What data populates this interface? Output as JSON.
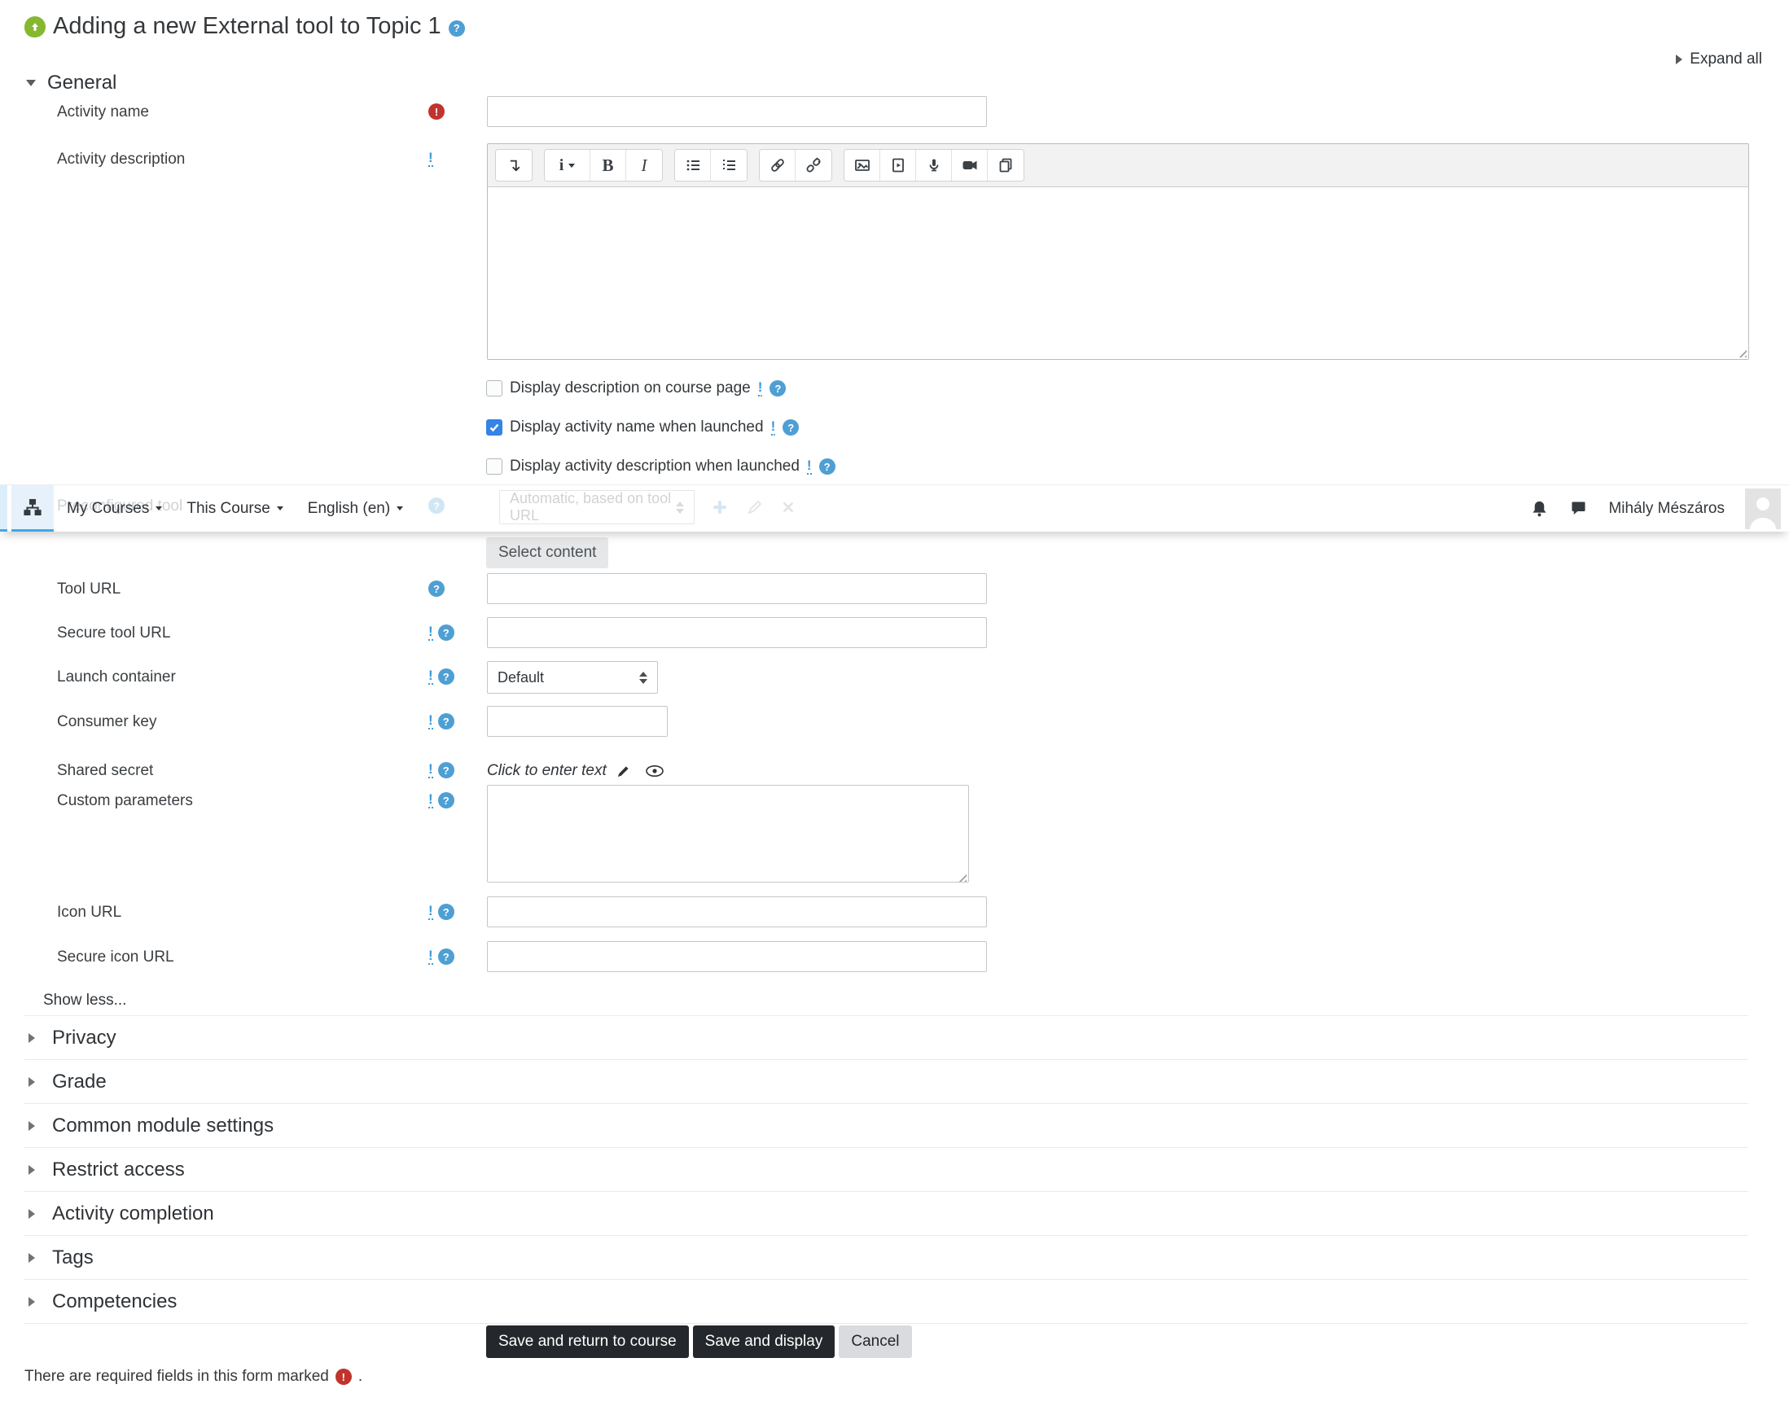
{
  "header": {
    "title": "Adding a new External tool to Topic 1",
    "expand_all": "Expand all"
  },
  "navbar": {
    "items": [
      {
        "label": "My Courses"
      },
      {
        "label": "This Course"
      },
      {
        "label": "English (en)"
      }
    ],
    "user_name": "Mihály Mészáros"
  },
  "general": {
    "heading": "General",
    "activity_name_label": "Activity name",
    "activity_description_label": "Activity description",
    "checkboxes": [
      {
        "label": "Display description on course page",
        "checked": false
      },
      {
        "label": "Display activity name when launched",
        "checked": true
      },
      {
        "label": "Display activity description when launched",
        "checked": false
      }
    ],
    "preconfigured_label": "Preconfigured tool",
    "preconfigured_value": "Automatic, based on tool URL",
    "select_content_label": "Select content",
    "fields": [
      {
        "label": "Tool URL"
      },
      {
        "label": "Secure tool URL"
      },
      {
        "label": "Launch container",
        "value": "Default"
      },
      {
        "label": "Consumer key"
      },
      {
        "label": "Shared secret",
        "value": "Click to enter text"
      },
      {
        "label": "Custom parameters"
      },
      {
        "label": "Icon URL"
      },
      {
        "label": "Secure icon URL"
      }
    ],
    "show_less": "Show less..."
  },
  "icons": {
    "help_glyph": "?",
    "required_glyph": "!",
    "warn_glyph": "!",
    "toolbar_toggle_glyph": "↴",
    "font_menu_glyph": "i",
    "bold_glyph": "B",
    "italic_glyph": "I"
  },
  "sections": [
    {
      "label": "Privacy"
    },
    {
      "label": "Grade"
    },
    {
      "label": "Common module settings"
    },
    {
      "label": "Restrict access"
    },
    {
      "label": "Activity completion"
    },
    {
      "label": "Tags"
    },
    {
      "label": "Competencies"
    }
  ],
  "footer": {
    "buttons": [
      {
        "label": "Save and return to course"
      },
      {
        "label": "Save and display"
      },
      {
        "label": "Cancel"
      }
    ],
    "required_note": "There are required fields in this form marked",
    "required_note_suffix": "."
  },
  "colors": {
    "accent_blue": "#3fa9ea",
    "help_blue": "#4e9fd3",
    "required_red": "#c0342d",
    "checkbox_blue": "#3584e4",
    "button_dark": "#24272b",
    "activity_green": "#85b82f"
  }
}
